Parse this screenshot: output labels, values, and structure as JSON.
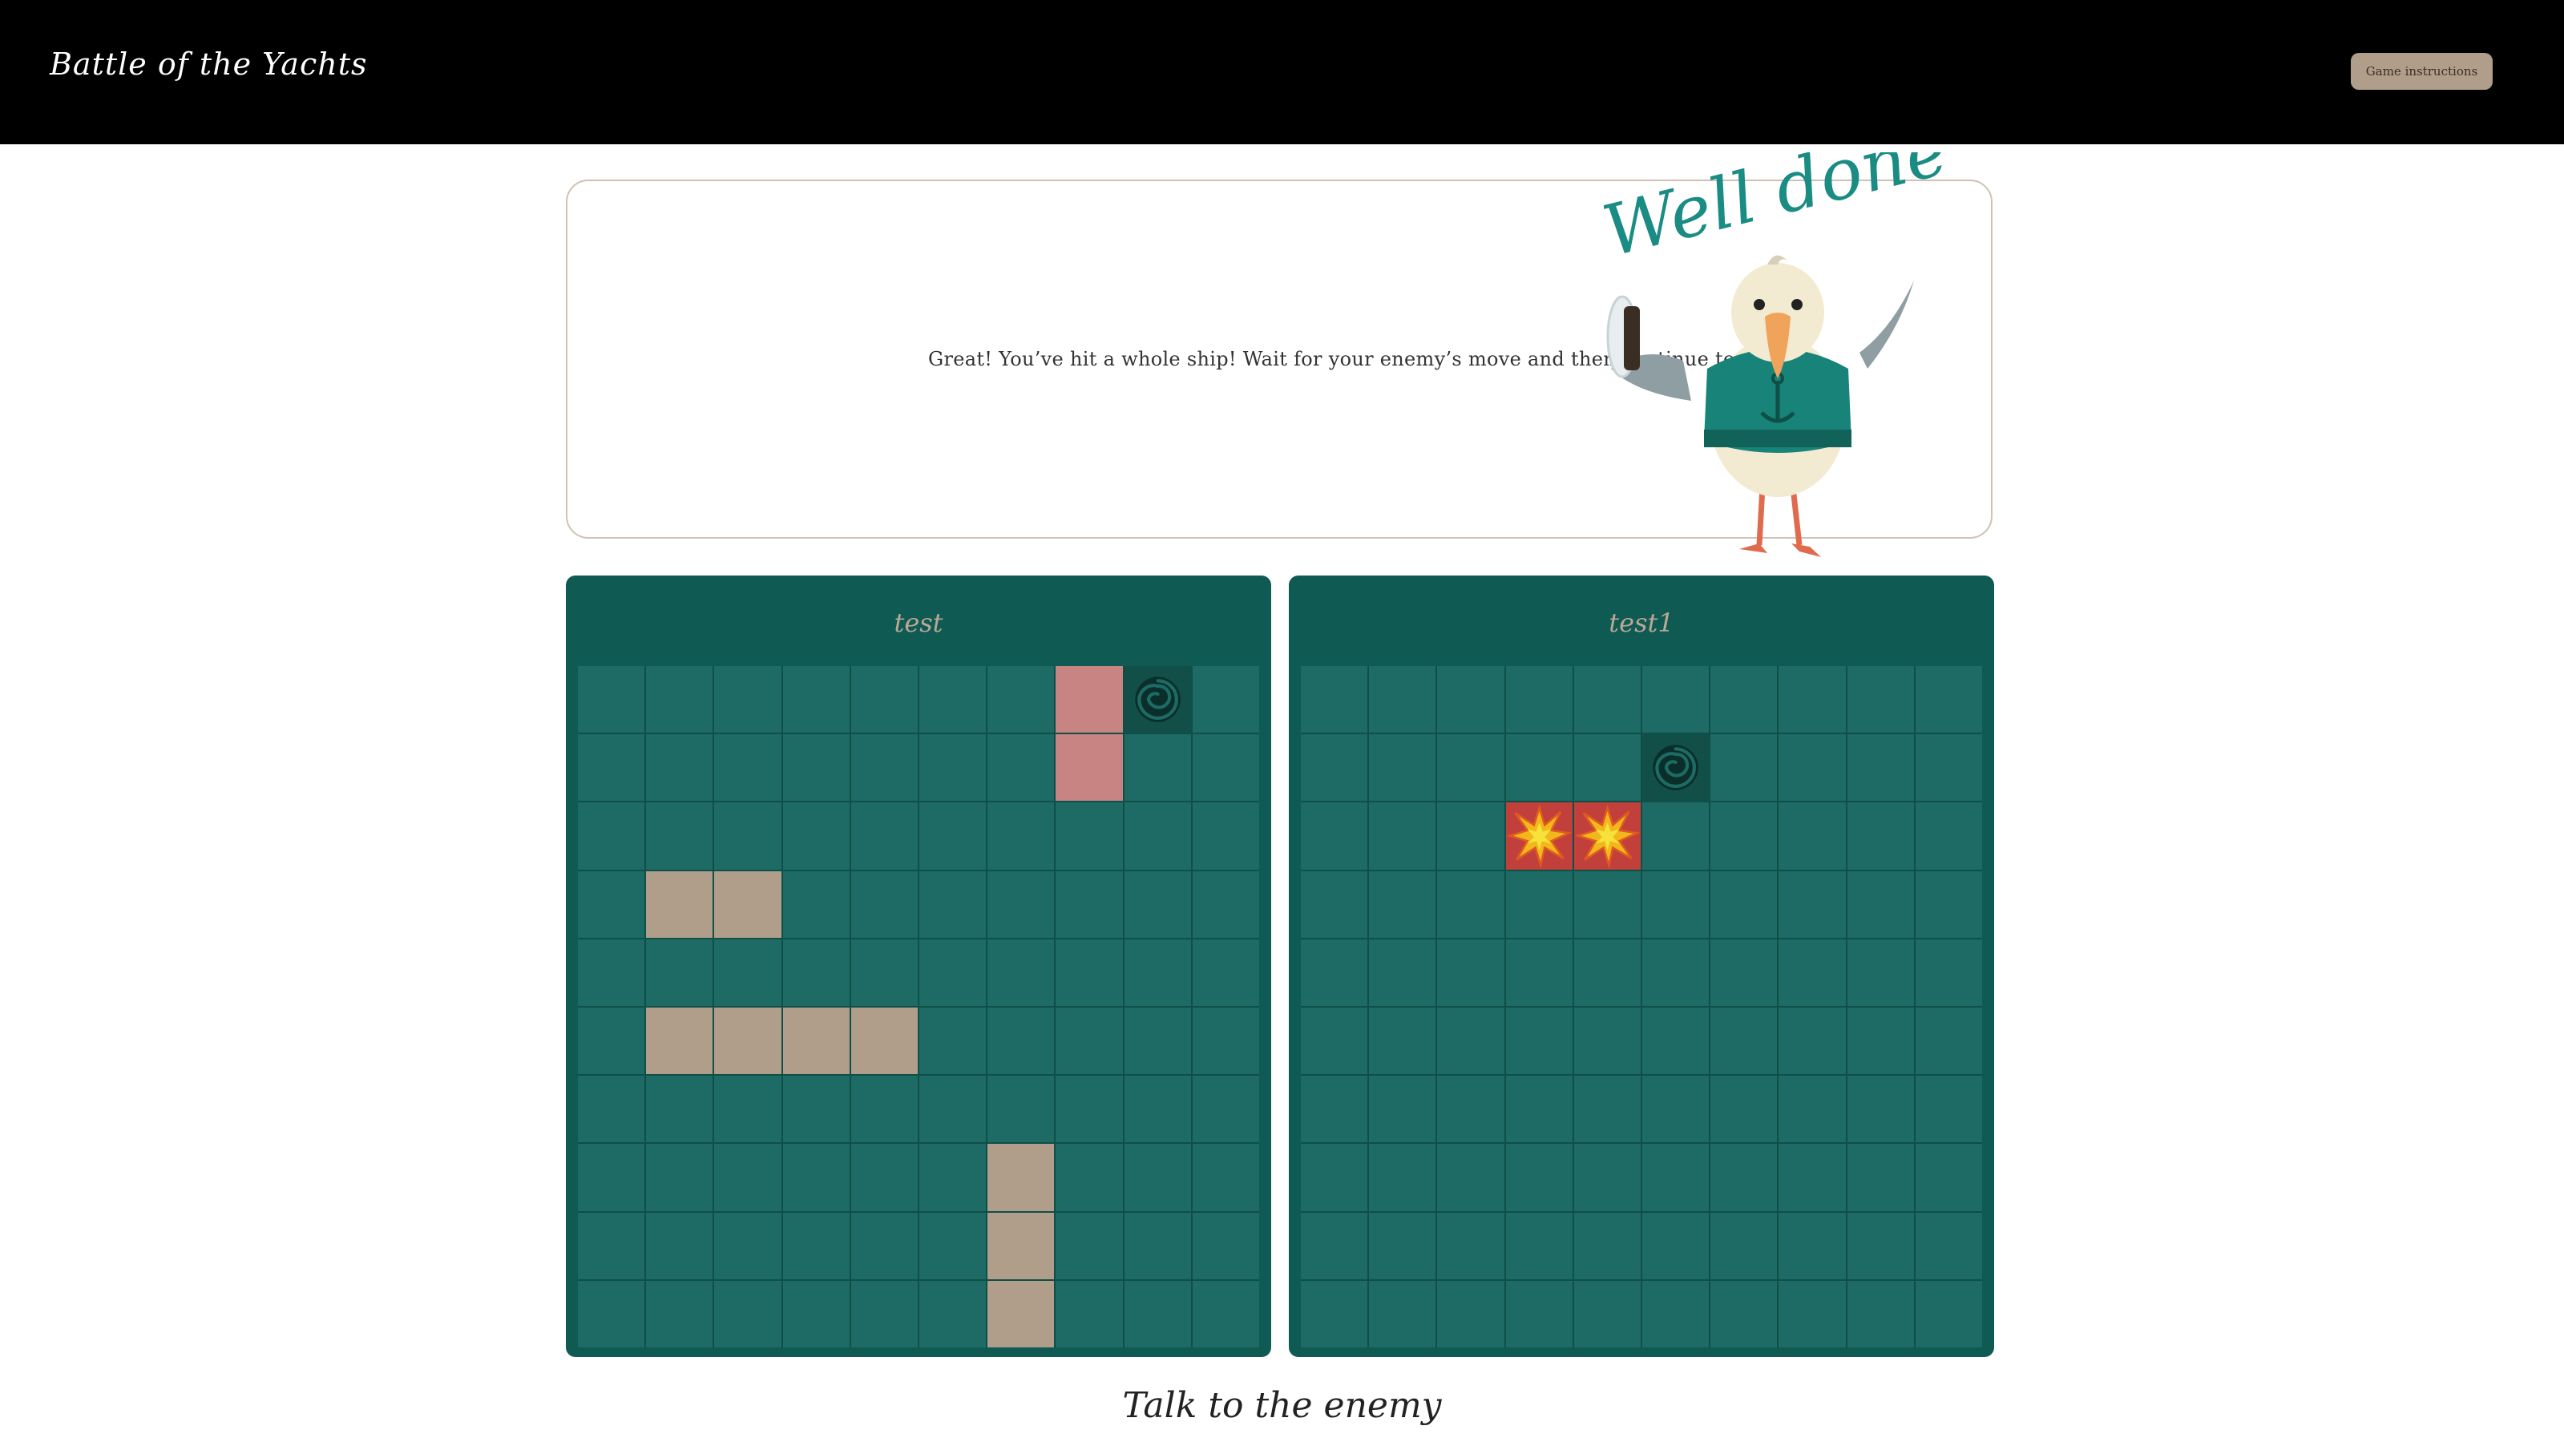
{
  "header": {
    "logo": "Battle of the Yachts",
    "instructions_button": "Game instructions"
  },
  "message": {
    "text": "Great! You’ve hit a whole ship! Wait for your enemy’s move and then continue to shoot.",
    "mascot_caption": "Well done!"
  },
  "boards": {
    "left": {
      "name": "test",
      "ships": [
        [
          0,
          7
        ],
        [
          1,
          7
        ],
        [
          3,
          1
        ],
        [
          3,
          2
        ],
        [
          5,
          1
        ],
        [
          5,
          2
        ],
        [
          5,
          3
        ],
        [
          5,
          4
        ],
        [
          7,
          6
        ],
        [
          8,
          6
        ],
        [
          9,
          6
        ]
      ],
      "sunk": [
        [
          0,
          7
        ],
        [
          1,
          7
        ]
      ],
      "misses": [
        [
          0,
          8
        ]
      ],
      "hits": []
    },
    "right": {
      "name": "test1",
      "ships": [],
      "sunk": [],
      "misses": [
        [
          1,
          5
        ]
      ],
      "hits": [
        [
          2,
          3
        ],
        [
          2,
          4
        ]
      ]
    }
  },
  "chat": {
    "title": "Talk to the enemy"
  },
  "colors": {
    "board": "#0f5a52",
    "cell": "#1d6b64",
    "ship": "#b09e8b",
    "sunk": "#c88383",
    "hit": "#c2403b"
  },
  "icons": {
    "miss": "whirlpool-icon",
    "hit": "explosion-icon"
  }
}
